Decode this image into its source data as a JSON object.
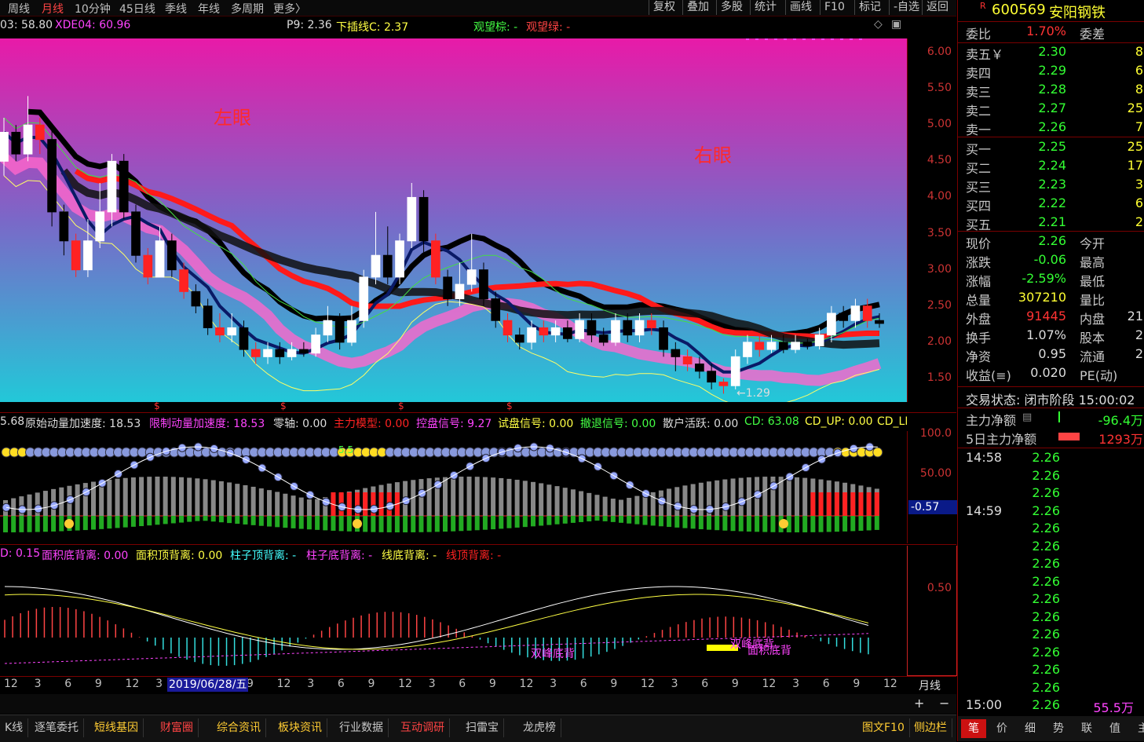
{
  "topbar": {
    "periods": [
      {
        "label": "周线",
        "active": false
      },
      {
        "label": "月线",
        "active": true
      },
      {
        "label": "10分钟",
        "active": false
      },
      {
        "label": "45日线",
        "active": false
      },
      {
        "label": "季线",
        "active": false
      },
      {
        "label": "年线",
        "active": false
      },
      {
        "label": "多周期",
        "active": false
      },
      {
        "label": "更多〉",
        "active": false
      }
    ],
    "tools": [
      "复权",
      "叠加",
      "多股",
      "统计",
      "画线",
      "F10",
      "标记",
      "-自选",
      "返回"
    ]
  },
  "main_chart": {
    "header": {
      "item1": "03: 58.80",
      "item2": "XDE04: 60.96",
      "item3": "P9: 2.36",
      "item4": "下插线C: 2.37",
      "item5": "观望棕: -",
      "item6": "观望绿: -"
    },
    "y_ticks": [
      "6.00",
      "5.50",
      "5.00",
      "4.50",
      "4.00",
      "3.50",
      "3.00",
      "2.50",
      "2.00",
      "1.50"
    ],
    "y_values": [
      6.0,
      5.5,
      5.0,
      4.5,
      4.0,
      3.5,
      3.0,
      2.5,
      2.0,
      1.5
    ],
    "label_left_eye": "左眼",
    "label_right_eye": "右眼",
    "min_label": "←1.29",
    "candles": [
      {
        "o": 4.5,
        "c": 4.9,
        "h": 5.1,
        "l": 4.3
      },
      {
        "o": 4.9,
        "c": 4.6,
        "h": 5.0,
        "l": 4.5
      },
      {
        "o": 4.6,
        "c": 5.0,
        "h": 5.4,
        "l": 4.5
      },
      {
        "o": 5.0,
        "c": 4.8,
        "h": 5.1,
        "l": 4.6
      },
      {
        "o": 4.8,
        "c": 3.8,
        "h": 5.0,
        "l": 3.6
      },
      {
        "o": 3.8,
        "c": 3.4,
        "h": 3.9,
        "l": 3.2
      },
      {
        "o": 3.4,
        "c": 3.0,
        "h": 3.5,
        "l": 2.9
      },
      {
        "o": 3.0,
        "c": 3.4,
        "h": 3.7,
        "l": 2.9
      },
      {
        "o": 3.4,
        "c": 3.8,
        "h": 4.2,
        "l": 3.3
      },
      {
        "o": 3.8,
        "c": 4.5,
        "h": 4.6,
        "l": 3.6
      },
      {
        "o": 4.5,
        "c": 3.8,
        "h": 4.6,
        "l": 3.7
      },
      {
        "o": 3.8,
        "c": 3.2,
        "h": 3.9,
        "l": 3.1
      },
      {
        "o": 3.2,
        "c": 2.9,
        "h": 3.3,
        "l": 2.8
      },
      {
        "o": 2.9,
        "c": 3.4,
        "h": 3.6,
        "l": 2.9
      },
      {
        "o": 3.4,
        "c": 3.0,
        "h": 3.5,
        "l": 2.9
      },
      {
        "o": 3.0,
        "c": 2.7,
        "h": 3.1,
        "l": 2.6
      },
      {
        "o": 2.7,
        "c": 2.5,
        "h": 2.8,
        "l": 2.4
      },
      {
        "o": 2.5,
        "c": 2.2,
        "h": 2.6,
        "l": 2.1
      },
      {
        "o": 2.2,
        "c": 2.1,
        "h": 2.4,
        "l": 2.0
      },
      {
        "o": 2.1,
        "c": 2.2,
        "h": 2.4,
        "l": 2.0
      },
      {
        "o": 2.2,
        "c": 1.9,
        "h": 2.3,
        "l": 1.8
      },
      {
        "o": 1.9,
        "c": 1.8,
        "h": 2.0,
        "l": 1.7
      },
      {
        "o": 1.8,
        "c": 1.9,
        "h": 2.0,
        "l": 1.7
      },
      {
        "o": 1.9,
        "c": 1.8,
        "h": 2.0,
        "l": 1.7
      },
      {
        "o": 1.8,
        "c": 1.9,
        "h": 2.0,
        "l": 1.75
      },
      {
        "o": 1.9,
        "c": 1.85,
        "h": 2.0,
        "l": 1.8
      },
      {
        "o": 1.85,
        "c": 2.1,
        "h": 2.2,
        "l": 1.8
      },
      {
        "o": 2.1,
        "c": 2.3,
        "h": 2.5,
        "l": 2.0
      },
      {
        "o": 2.3,
        "c": 2.0,
        "h": 2.4,
        "l": 1.9
      },
      {
        "o": 2.0,
        "c": 2.3,
        "h": 2.5,
        "l": 1.95
      },
      {
        "o": 2.3,
        "c": 2.9,
        "h": 3.0,
        "l": 2.2
      },
      {
        "o": 2.9,
        "c": 3.2,
        "h": 3.8,
        "l": 2.8
      },
      {
        "o": 3.2,
        "c": 2.9,
        "h": 3.6,
        "l": 2.8
      },
      {
        "o": 2.9,
        "c": 3.4,
        "h": 3.5,
        "l": 2.8
      },
      {
        "o": 3.4,
        "c": 4.0,
        "h": 4.2,
        "l": 3.3
      },
      {
        "o": 4.0,
        "c": 3.4,
        "h": 4.1,
        "l": 3.2
      },
      {
        "o": 3.4,
        "c": 2.9,
        "h": 3.5,
        "l": 2.8
      },
      {
        "o": 2.9,
        "c": 2.6,
        "h": 3.0,
        "l": 2.5
      },
      {
        "o": 2.6,
        "c": 2.8,
        "h": 3.1,
        "l": 2.5
      },
      {
        "o": 2.8,
        "c": 3.0,
        "h": 3.5,
        "l": 2.7
      },
      {
        "o": 3.0,
        "c": 2.6,
        "h": 3.1,
        "l": 2.5
      },
      {
        "o": 2.6,
        "c": 2.3,
        "h": 2.7,
        "l": 2.2
      },
      {
        "o": 2.3,
        "c": 2.1,
        "h": 2.4,
        "l": 2.0
      },
      {
        "o": 2.1,
        "c": 2.0,
        "h": 2.2,
        "l": 1.9
      },
      {
        "o": 2.0,
        "c": 2.2,
        "h": 2.3,
        "l": 1.9
      },
      {
        "o": 2.2,
        "c": 2.1,
        "h": 2.3,
        "l": 2.0
      },
      {
        "o": 2.1,
        "c": 2.2,
        "h": 2.3,
        "l": 2.0
      },
      {
        "o": 2.2,
        "c": 2.05,
        "h": 2.3,
        "l": 2.0
      },
      {
        "o": 2.05,
        "c": 2.3,
        "h": 2.4,
        "l": 2.0
      },
      {
        "o": 2.3,
        "c": 2.1,
        "h": 2.4,
        "l": 2.0
      },
      {
        "o": 2.1,
        "c": 2.0,
        "h": 2.2,
        "l": 1.95
      },
      {
        "o": 2.0,
        "c": 2.3,
        "h": 2.4,
        "l": 1.95
      },
      {
        "o": 2.3,
        "c": 2.1,
        "h": 2.4,
        "l": 2.0
      },
      {
        "o": 2.1,
        "c": 2.3,
        "h": 2.4,
        "l": 2.0
      },
      {
        "o": 2.3,
        "c": 2.2,
        "h": 2.4,
        "l": 2.1
      },
      {
        "o": 2.2,
        "c": 1.9,
        "h": 2.3,
        "l": 1.8
      },
      {
        "o": 1.9,
        "c": 1.8,
        "h": 2.0,
        "l": 1.6
      },
      {
        "o": 1.8,
        "c": 1.7,
        "h": 1.9,
        "l": 1.6
      },
      {
        "o": 1.7,
        "c": 1.6,
        "h": 1.8,
        "l": 1.5
      },
      {
        "o": 1.6,
        "c": 1.45,
        "h": 1.7,
        "l": 1.35
      },
      {
        "o": 1.45,
        "c": 1.4,
        "h": 1.5,
        "l": 1.29
      },
      {
        "o": 1.4,
        "c": 1.8,
        "h": 1.9,
        "l": 1.35
      },
      {
        "o": 1.8,
        "c": 2.0,
        "h": 2.1,
        "l": 1.7
      },
      {
        "o": 2.0,
        "c": 1.9,
        "h": 2.1,
        "l": 1.8
      },
      {
        "o": 1.9,
        "c": 2.0,
        "h": 2.1,
        "l": 1.85
      },
      {
        "o": 2.0,
        "c": 1.9,
        "h": 2.1,
        "l": 1.85
      },
      {
        "o": 1.9,
        "c": 2.0,
        "h": 2.1,
        "l": 1.85
      },
      {
        "o": 2.0,
        "c": 1.95,
        "h": 2.05,
        "l": 1.9
      },
      {
        "o": 1.95,
        "c": 2.1,
        "h": 2.2,
        "l": 1.9
      },
      {
        "o": 2.1,
        "c": 2.4,
        "h": 2.5,
        "l": 2.0
      },
      {
        "o": 2.4,
        "c": 2.3,
        "h": 2.5,
        "l": 2.2
      },
      {
        "o": 2.3,
        "c": 2.5,
        "h": 2.6,
        "l": 2.2
      },
      {
        "o": 2.5,
        "c": 2.3,
        "h": 2.6,
        "l": 2.2
      },
      {
        "o": 2.3,
        "c": 2.26,
        "h": 2.4,
        "l": 2.2
      }
    ]
  },
  "mid_chart": {
    "header": {
      "item1": "5.68",
      "item2": "原始动量加速度: 18.53",
      "item3": "限制动量加速度: 18.53",
      "item4": "零轴: 0.00",
      "item5": "主力模型: 0.00",
      "item6": "控盘信号: 9.27",
      "item7": "试盘信号: 0.00",
      "item8": "撤退信号: 0.00",
      "item9": "散户活跃: 0.00",
      "item10": "CD: 63.08",
      "item11": "CD_UP: 0.00",
      "item12": "CD_LI"
    },
    "y_ticks": [
      "100.0",
      "50.00"
    ],
    "current_value": "-0.57",
    "small_text": "5.5"
  },
  "bottom_chart": {
    "header": {
      "item1": "D: 0.15",
      "item2": "面积底背离: 0.00",
      "item3": "面积顶背离: 0.00",
      "item4": "柱子顶背离: -",
      "item5": "柱子底背离: -",
      "item6": "线底背离: -",
      "item7": "线顶背离: -"
    },
    "y_tick": "0.50",
    "annotations": [
      "双峰底背",
      "双峰底背",
      "面积底背"
    ]
  },
  "x_axis": {
    "ticks": [
      "12",
      "3",
      "6",
      "9",
      "12",
      "3",
      "3",
      "6",
      "9",
      "12",
      "3",
      "6",
      "9",
      "12",
      "3",
      "6",
      "9",
      "12",
      "3",
      "6",
      "9",
      "12",
      "3",
      "6",
      "9",
      "12",
      "3",
      "6",
      "9",
      "12"
    ],
    "highlight_date": "2019/06/28/五",
    "period_label": "月线"
  },
  "bottombar": {
    "tabs": [
      {
        "label": "K线",
        "color": "#c8c8c8"
      },
      {
        "label": "逐笔委托",
        "color": "#c8c8c8"
      },
      {
        "label": "短线基因",
        "color": "#ffcc33"
      },
      {
        "label": "财富圈",
        "color": "#ff4444"
      },
      {
        "label": "综合资讯",
        "color": "#ffcc33"
      },
      {
        "label": "板块资讯",
        "color": "#ffcc33"
      },
      {
        "label": "行业数据",
        "color": "#c8c8c8"
      },
      {
        "label": "互动调研",
        "color": "#ff4444"
      },
      {
        "label": "扫雷宝",
        "color": "#c8c8c8"
      },
      {
        "label": "龙虎榜",
        "color": "#c8c8c8"
      }
    ],
    "right_items": [
      "图文F10",
      "侧边栏"
    ],
    "plus": "+",
    "minus": "−"
  },
  "right_panel": {
    "badge": "R",
    "stock_code": "600569",
    "stock_name": "安阳钢铁",
    "weibi_label": "委比",
    "weibi_value": "1.70%",
    "weicha_label": "委差",
    "sell": [
      {
        "label": "卖五￥",
        "price": "2.30",
        "vol": "8"
      },
      {
        "label": "卖四",
        "price": "2.29",
        "vol": "6"
      },
      {
        "label": "卖三",
        "price": "2.28",
        "vol": "8"
      },
      {
        "label": "卖二",
        "price": "2.27",
        "vol": "25"
      },
      {
        "label": "卖一",
        "price": "2.26",
        "vol": "7"
      }
    ],
    "buy": [
      {
        "label": "买一",
        "price": "2.25",
        "vol": "25"
      },
      {
        "label": "买二",
        "price": "2.24",
        "vol": "17"
      },
      {
        "label": "买三",
        "price": "2.23",
        "vol": "3"
      },
      {
        "label": "买四",
        "price": "2.22",
        "vol": "6"
      },
      {
        "label": "买五",
        "price": "2.21",
        "vol": "2"
      }
    ],
    "quote": [
      {
        "label": "现价",
        "value": "2.26",
        "color": "green",
        "label2": "今开"
      },
      {
        "label": "涨跌",
        "value": "-0.06",
        "color": "green",
        "label2": "最高"
      },
      {
        "label": "涨幅",
        "value": "-2.59%",
        "color": "green",
        "label2": "最低"
      },
      {
        "label": "总量",
        "value": "307210",
        "color": "yellow",
        "label2": "量比"
      },
      {
        "label": "外盘",
        "value": "91445",
        "color": "red",
        "label2": "内盘",
        "val2": "21"
      },
      {
        "label": "换手",
        "value": "1.07%",
        "color": "white",
        "label2": "股本",
        "val2": "2"
      },
      {
        "label": "净资",
        "value": "0.95",
        "color": "white",
        "label2": "流通",
        "val2": "2"
      },
      {
        "label": "收益(≡)",
        "value": "0.020",
        "color": "white",
        "label2": "PE(动)"
      }
    ],
    "trade_status": "交易状态: 闭市阶段 15:00:02",
    "main_net_label": "主力净额",
    "main_net_value": "-96.4万",
    "main_net5_label": "5日主力净额",
    "main_net5_value": "1293万",
    "ticks": [
      {
        "time": "14:58",
        "price": "2.26"
      },
      {
        "time": "",
        "price": "2.26"
      },
      {
        "time": "",
        "price": "2.26"
      },
      {
        "time": "14:59",
        "price": "2.26"
      },
      {
        "time": "",
        "price": "2.26"
      },
      {
        "time": "",
        "price": "2.26"
      },
      {
        "time": "",
        "price": "2.26"
      },
      {
        "time": "",
        "price": "2.26"
      },
      {
        "time": "",
        "price": "2.26"
      },
      {
        "time": "",
        "price": "2.26"
      },
      {
        "time": "",
        "price": "2.26"
      },
      {
        "time": "",
        "price": "2.26"
      },
      {
        "time": "",
        "price": "2.26"
      },
      {
        "time": "",
        "price": "2.26"
      },
      {
        "time": "15:00",
        "price": "2.26",
        "vol": "55.5万"
      }
    ],
    "tabs": [
      "笔",
      "价",
      "细",
      "势",
      "联",
      "值",
      "主"
    ]
  },
  "colors": {
    "up": "#ff2222",
    "down": "#000000",
    "bg": "#000000",
    "grid": "#7a0000"
  }
}
